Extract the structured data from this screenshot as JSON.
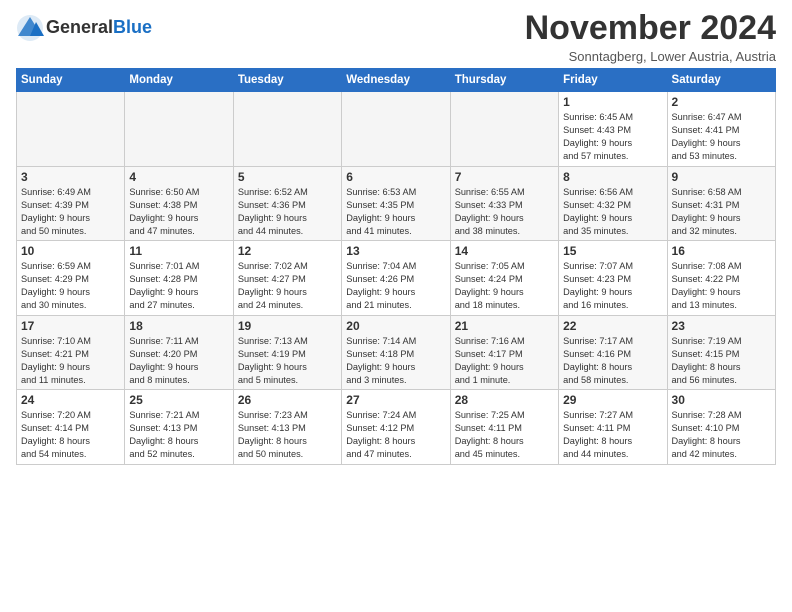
{
  "logo": {
    "line1": "General",
    "line2": "Blue"
  },
  "title": "November 2024",
  "subtitle": "Sonntagberg, Lower Austria, Austria",
  "days_of_week": [
    "Sunday",
    "Monday",
    "Tuesday",
    "Wednesday",
    "Thursday",
    "Friday",
    "Saturday"
  ],
  "weeks": [
    [
      {
        "day": "",
        "info": "",
        "empty": true
      },
      {
        "day": "",
        "info": "",
        "empty": true
      },
      {
        "day": "",
        "info": "",
        "empty": true
      },
      {
        "day": "",
        "info": "",
        "empty": true
      },
      {
        "day": "",
        "info": "",
        "empty": true
      },
      {
        "day": "1",
        "info": "Sunrise: 6:45 AM\nSunset: 4:43 PM\nDaylight: 9 hours\nand 57 minutes."
      },
      {
        "day": "2",
        "info": "Sunrise: 6:47 AM\nSunset: 4:41 PM\nDaylight: 9 hours\nand 53 minutes."
      }
    ],
    [
      {
        "day": "3",
        "info": "Sunrise: 6:49 AM\nSunset: 4:39 PM\nDaylight: 9 hours\nand 50 minutes."
      },
      {
        "day": "4",
        "info": "Sunrise: 6:50 AM\nSunset: 4:38 PM\nDaylight: 9 hours\nand 47 minutes."
      },
      {
        "day": "5",
        "info": "Sunrise: 6:52 AM\nSunset: 4:36 PM\nDaylight: 9 hours\nand 44 minutes."
      },
      {
        "day": "6",
        "info": "Sunrise: 6:53 AM\nSunset: 4:35 PM\nDaylight: 9 hours\nand 41 minutes."
      },
      {
        "day": "7",
        "info": "Sunrise: 6:55 AM\nSunset: 4:33 PM\nDaylight: 9 hours\nand 38 minutes."
      },
      {
        "day": "8",
        "info": "Sunrise: 6:56 AM\nSunset: 4:32 PM\nDaylight: 9 hours\nand 35 minutes."
      },
      {
        "day": "9",
        "info": "Sunrise: 6:58 AM\nSunset: 4:31 PM\nDaylight: 9 hours\nand 32 minutes."
      }
    ],
    [
      {
        "day": "10",
        "info": "Sunrise: 6:59 AM\nSunset: 4:29 PM\nDaylight: 9 hours\nand 30 minutes."
      },
      {
        "day": "11",
        "info": "Sunrise: 7:01 AM\nSunset: 4:28 PM\nDaylight: 9 hours\nand 27 minutes."
      },
      {
        "day": "12",
        "info": "Sunrise: 7:02 AM\nSunset: 4:27 PM\nDaylight: 9 hours\nand 24 minutes."
      },
      {
        "day": "13",
        "info": "Sunrise: 7:04 AM\nSunset: 4:26 PM\nDaylight: 9 hours\nand 21 minutes."
      },
      {
        "day": "14",
        "info": "Sunrise: 7:05 AM\nSunset: 4:24 PM\nDaylight: 9 hours\nand 18 minutes."
      },
      {
        "day": "15",
        "info": "Sunrise: 7:07 AM\nSunset: 4:23 PM\nDaylight: 9 hours\nand 16 minutes."
      },
      {
        "day": "16",
        "info": "Sunrise: 7:08 AM\nSunset: 4:22 PM\nDaylight: 9 hours\nand 13 minutes."
      }
    ],
    [
      {
        "day": "17",
        "info": "Sunrise: 7:10 AM\nSunset: 4:21 PM\nDaylight: 9 hours\nand 11 minutes."
      },
      {
        "day": "18",
        "info": "Sunrise: 7:11 AM\nSunset: 4:20 PM\nDaylight: 9 hours\nand 8 minutes."
      },
      {
        "day": "19",
        "info": "Sunrise: 7:13 AM\nSunset: 4:19 PM\nDaylight: 9 hours\nand 5 minutes."
      },
      {
        "day": "20",
        "info": "Sunrise: 7:14 AM\nSunset: 4:18 PM\nDaylight: 9 hours\nand 3 minutes."
      },
      {
        "day": "21",
        "info": "Sunrise: 7:16 AM\nSunset: 4:17 PM\nDaylight: 9 hours\nand 1 minute."
      },
      {
        "day": "22",
        "info": "Sunrise: 7:17 AM\nSunset: 4:16 PM\nDaylight: 8 hours\nand 58 minutes."
      },
      {
        "day": "23",
        "info": "Sunrise: 7:19 AM\nSunset: 4:15 PM\nDaylight: 8 hours\nand 56 minutes."
      }
    ],
    [
      {
        "day": "24",
        "info": "Sunrise: 7:20 AM\nSunset: 4:14 PM\nDaylight: 8 hours\nand 54 minutes."
      },
      {
        "day": "25",
        "info": "Sunrise: 7:21 AM\nSunset: 4:13 PM\nDaylight: 8 hours\nand 52 minutes."
      },
      {
        "day": "26",
        "info": "Sunrise: 7:23 AM\nSunset: 4:13 PM\nDaylight: 8 hours\nand 50 minutes."
      },
      {
        "day": "27",
        "info": "Sunrise: 7:24 AM\nSunset: 4:12 PM\nDaylight: 8 hours\nand 47 minutes."
      },
      {
        "day": "28",
        "info": "Sunrise: 7:25 AM\nSunset: 4:11 PM\nDaylight: 8 hours\nand 45 minutes."
      },
      {
        "day": "29",
        "info": "Sunrise: 7:27 AM\nSunset: 4:11 PM\nDaylight: 8 hours\nand 44 minutes."
      },
      {
        "day": "30",
        "info": "Sunrise: 7:28 AM\nSunset: 4:10 PM\nDaylight: 8 hours\nand 42 minutes."
      }
    ]
  ]
}
